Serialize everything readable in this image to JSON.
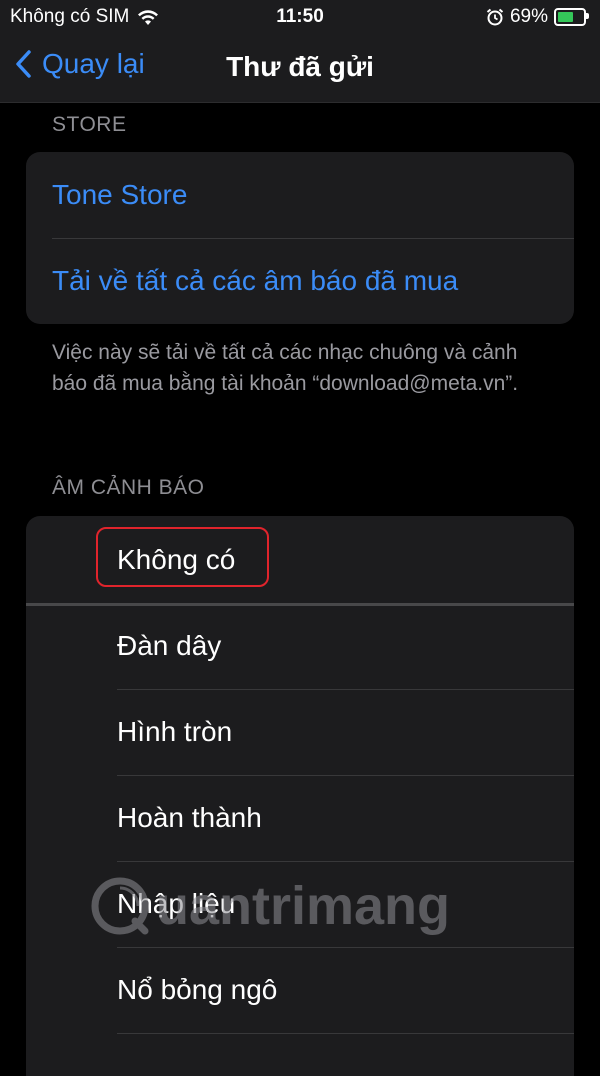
{
  "status_bar": {
    "carrier": "Không có SIM",
    "time": "11:50",
    "battery_percent": "69%",
    "battery_level": 0.69,
    "icons": [
      "wifi-icon",
      "alarm-icon",
      "battery-charging-icon"
    ]
  },
  "nav": {
    "back_label": "Quay lại",
    "title": "Thư đã gửi"
  },
  "store": {
    "header": "STORE",
    "items": [
      "Tone Store",
      "Tải về tất cả các âm báo đã mua"
    ],
    "footnote": "Việc này sẽ tải về tất cả các nhạc chuông và cảnh báo đã mua bằng tài khoản “download@meta.vn”."
  },
  "alerts": {
    "header": "ÂM CẢNH BÁO",
    "items": [
      "Không có",
      "Đàn dây",
      "Hình tròn",
      "Hoàn thành",
      "Nhập liệu",
      "Nổ bỏng ngô"
    ],
    "selected": "Không có"
  },
  "watermark": "uantrimang",
  "colors": {
    "accent": "#3b8cf7",
    "background": "#000000",
    "cell": "#1c1c1e",
    "highlight": "#e0242c",
    "battery": "#34c759"
  }
}
